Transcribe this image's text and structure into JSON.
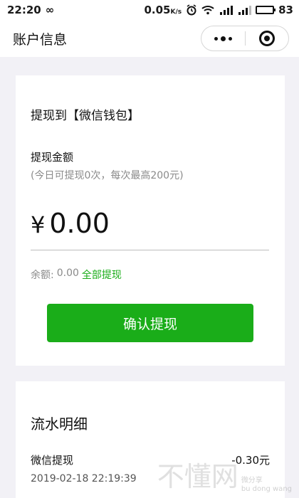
{
  "status_bar": {
    "time": "22:20",
    "loop_glyph": "∞",
    "speed": "0.05",
    "speed_unit": "K/s",
    "battery": "83",
    "icons": [
      "alarm-icon",
      "wifi-icon",
      "signal-4g-icon",
      "signal-3g-icon",
      "battery-icon"
    ]
  },
  "nav": {
    "title": "账户信息",
    "menu_icon": "more-dots-icon",
    "close_icon": "target-close-icon"
  },
  "withdraw": {
    "title": "提现到【微信钱包】",
    "amount_label": "提现金额",
    "amount_hint": "(今日可提现0次，每次最高200元)",
    "currency": "¥",
    "amount_value": "0.00",
    "balance_label": "余额:",
    "balance_value": "0.00",
    "withdraw_all_label": "全部提现",
    "confirm_label": "确认提现"
  },
  "flow": {
    "title": "流水明细",
    "items": [
      {
        "name": "微信提现",
        "amount": "-0.30元",
        "time": "2019-02-18 22:19:39"
      }
    ]
  },
  "watermark": {
    "main": "不懂网",
    "sub1": "微分享",
    "sub2": "bu dong wang"
  },
  "colors": {
    "accent": "#1aad19",
    "background": "#f2f1f6"
  }
}
